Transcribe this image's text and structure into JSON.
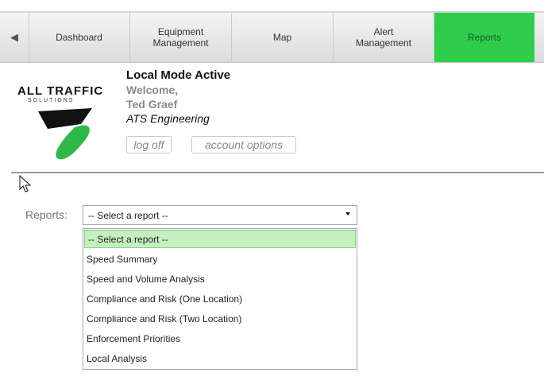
{
  "nav": {
    "back_arrow": "◀",
    "tabs": [
      {
        "label": "Dashboard",
        "active": false
      },
      {
        "label": "Equipment Management",
        "active": false
      },
      {
        "label": "Map",
        "active": false
      },
      {
        "label": "Alert Management",
        "active": false
      },
      {
        "label": "Reports",
        "active": true
      }
    ],
    "active_color": "#2fce4a"
  },
  "logo": {
    "line1": "ALL TRAFFIC",
    "line2": "SOLUTIONS"
  },
  "header": {
    "mode": "Local Mode Active",
    "welcome": "Welcome,",
    "user_name": "Ted Graef",
    "company": "ATS Engineering",
    "logoff_label": "log off",
    "account_label": "account options"
  },
  "reports": {
    "label": "Reports:",
    "selected_value": "-- Select a report --",
    "options": [
      "-- Select a report --",
      "Speed Summary",
      "Speed and Volume Analysis",
      "Compliance and Risk (One Location)",
      "Compliance and Risk (Two Location)",
      "Enforcement Priorities",
      "Local Analysis"
    ],
    "highlight_color": "#c4f0c0"
  }
}
